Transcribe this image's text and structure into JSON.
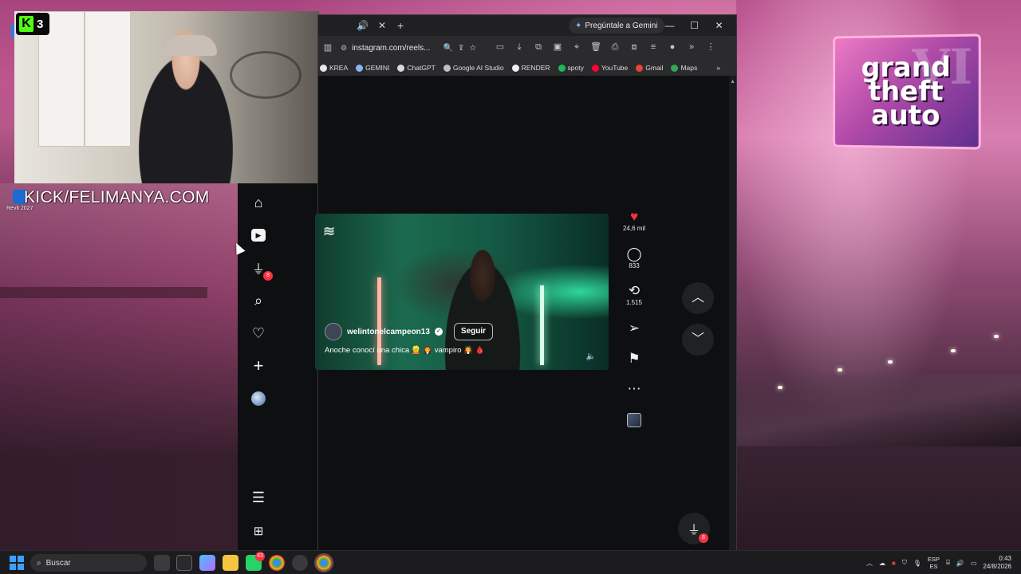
{
  "stream": {
    "kick_badge_letter": "K",
    "kick_badge_count": "3",
    "kick_url": "KICK/FELIMANYA.COM"
  },
  "desktop": {
    "revit_label": "Revit 2027",
    "gta_logo": {
      "line1": "grand",
      "line2": "theft",
      "line3": "auto",
      "numeral": "VI"
    }
  },
  "browser": {
    "gemini_label": "Pregúntale a Gemini",
    "url": "instagram.com/reels...",
    "window_controls": {
      "minimize": "—",
      "maximize": "☐",
      "close": "✕"
    },
    "bookmarks": [
      {
        "label": "KREA",
        "color": "#e8e8e8"
      },
      {
        "label": "GEMINI",
        "color": "#8ab4f8"
      },
      {
        "label": "ChatGPT",
        "color": "#d9d9d9"
      },
      {
        "label": "Google AI Studio",
        "color": "#c0c0c0"
      },
      {
        "label": "RENDER",
        "color": "#f0f0f0"
      },
      {
        "label": "spoty",
        "color": "#1db954"
      },
      {
        "label": "YouTube",
        "color": "#ff0033"
      },
      {
        "label": "Gmail",
        "color": "#ea4335"
      },
      {
        "label": "Maps",
        "color": "#34a853"
      }
    ]
  },
  "instagram": {
    "nav_badge_count": "8",
    "reel": {
      "username": "welintonelcampeon13",
      "follow_label": "Seguir",
      "caption": "Anoche conocí una chica 👱 🧛 vampiro 🧛 🩸"
    },
    "actions": {
      "likes": "24,6 mil",
      "comments": "833",
      "reposts": "1.515"
    },
    "messages_badge": "8"
  },
  "taskbar": {
    "search_placeholder": "Buscar",
    "chrome_badge": "43",
    "language_top": "ESP",
    "language_bottom": "ES",
    "time": "0:43",
    "date": "24/8/2026"
  },
  "colors": {
    "like_red": "#ff3040",
    "kick_green": "#53fc18",
    "windows_blue": "#3aa0ff"
  }
}
